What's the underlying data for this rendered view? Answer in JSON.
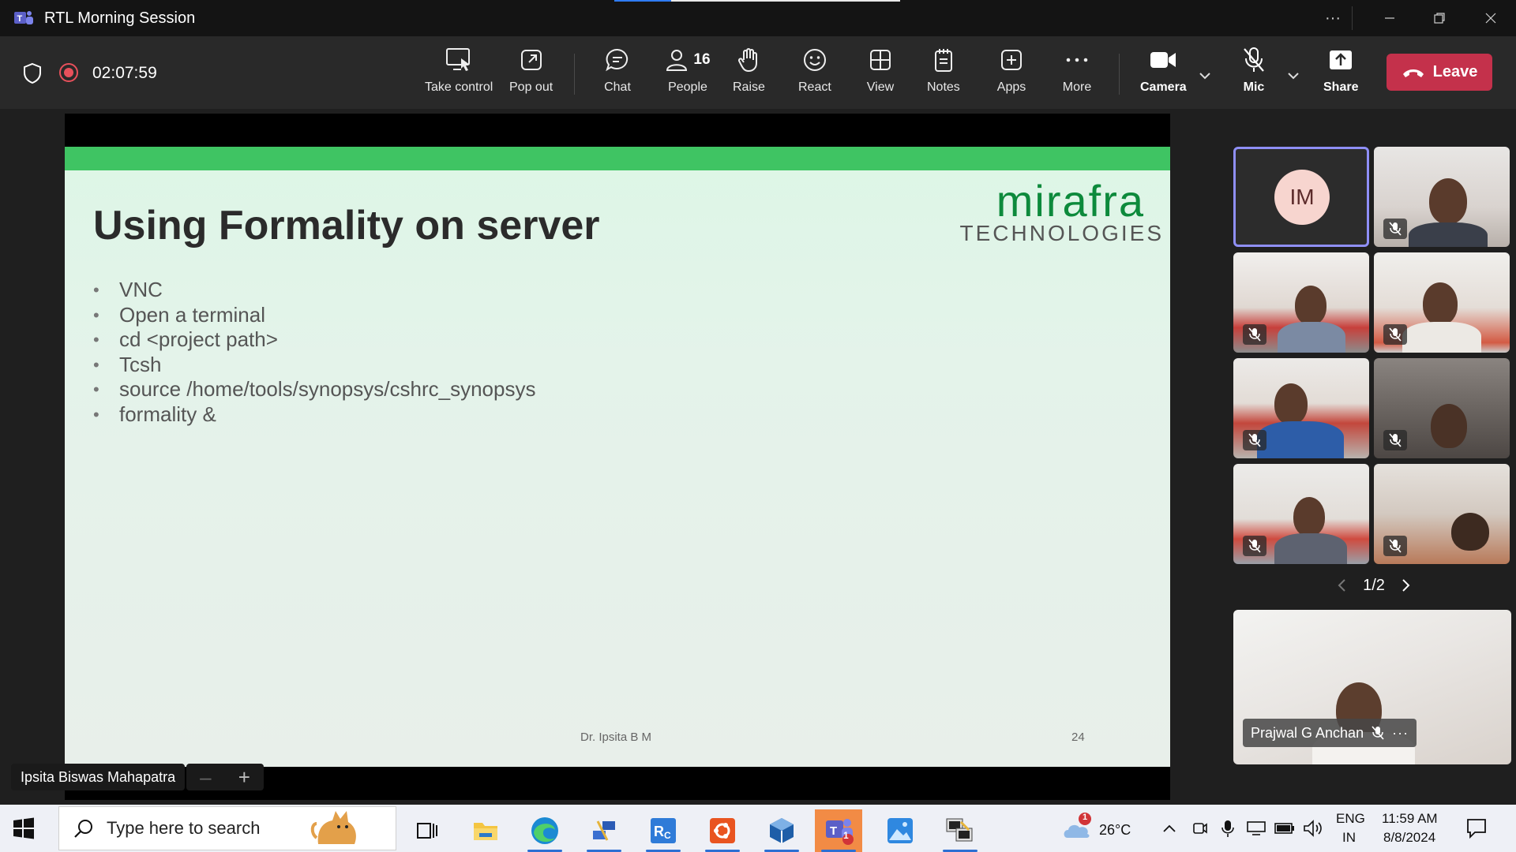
{
  "window": {
    "title": "RTL Morning Session"
  },
  "meeting": {
    "timer": "02:07:59",
    "people_count": "16"
  },
  "toolbar": {
    "take_control": "Take control",
    "pop_out": "Pop out",
    "chat": "Chat",
    "people": "People",
    "raise": "Raise",
    "react": "React",
    "view": "View",
    "notes": "Notes",
    "apps": "Apps",
    "more": "More",
    "camera": "Camera",
    "mic": "Mic",
    "share": "Share",
    "leave": "Leave"
  },
  "slide": {
    "title": "Using Formality on server",
    "brand": "mirafra",
    "brand_sub": "TECHNOLOGIES",
    "bullets": [
      "VNC",
      "Open a terminal",
      "cd <project path>",
      "Tcsh",
      "source /home/tools/synopsys/cshrc_synopsys",
      "formality &"
    ],
    "footer_name": "Dr. Ipsita B M",
    "page_number": "24"
  },
  "presenter": {
    "name": "Ipsita Biswas Mahapatra"
  },
  "gallery": {
    "avatar_initials": "IM",
    "pager": "1/2",
    "spotlight_name": "Prajwal G Anchan"
  },
  "taskbar": {
    "search_placeholder": "Type here to search",
    "weather_temp": "26°C",
    "weather_badge": "1",
    "teams_badge": "1",
    "lang_top": "ENG",
    "lang_bottom": "IN",
    "time": "11:59 AM",
    "date": "8/8/2024"
  },
  "colors": {
    "leave_button": "#c4314b",
    "slide_band": "#3fc463",
    "brand": "#0d8a3c",
    "active_speaker": "#8f8ff7"
  }
}
